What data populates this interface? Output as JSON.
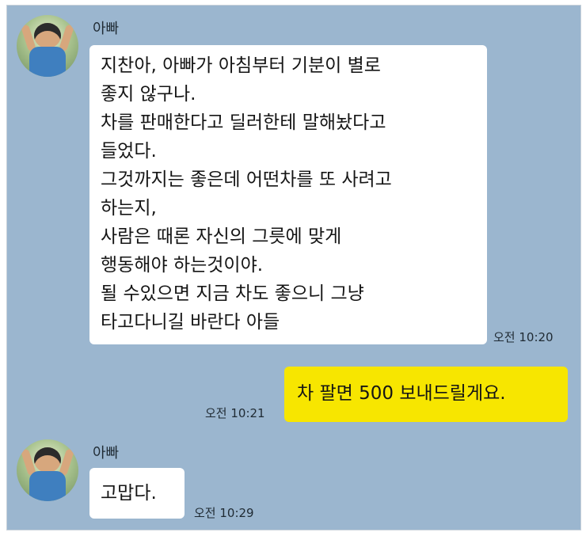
{
  "messages": [
    {
      "sender": "아빠",
      "lines": [
        "지찬아, 아빠가 아침부터 기분이 별로",
        "좋지 않구나.",
        "차를 판매한다고 딜러한테 말해놨다고",
        "들었다.",
        "그것까지는 좋은데 어떤차를 또 사려고",
        "하는지,",
        "사람은 때론 자신의 그릇에 맞게",
        "행동해야 하는것이야.",
        "될 수있으면 지금 차도 좋으니 그냥",
        "타고다니길 바란다 아들"
      ],
      "time": "오전 10:20"
    },
    {
      "sender": "",
      "lines": [
        "차 팔면 500 보내드릴게요."
      ],
      "time": "오전 10:21"
    },
    {
      "sender": "아빠",
      "lines": [
        "고맙다."
      ],
      "time": "오전 10:29"
    }
  ]
}
